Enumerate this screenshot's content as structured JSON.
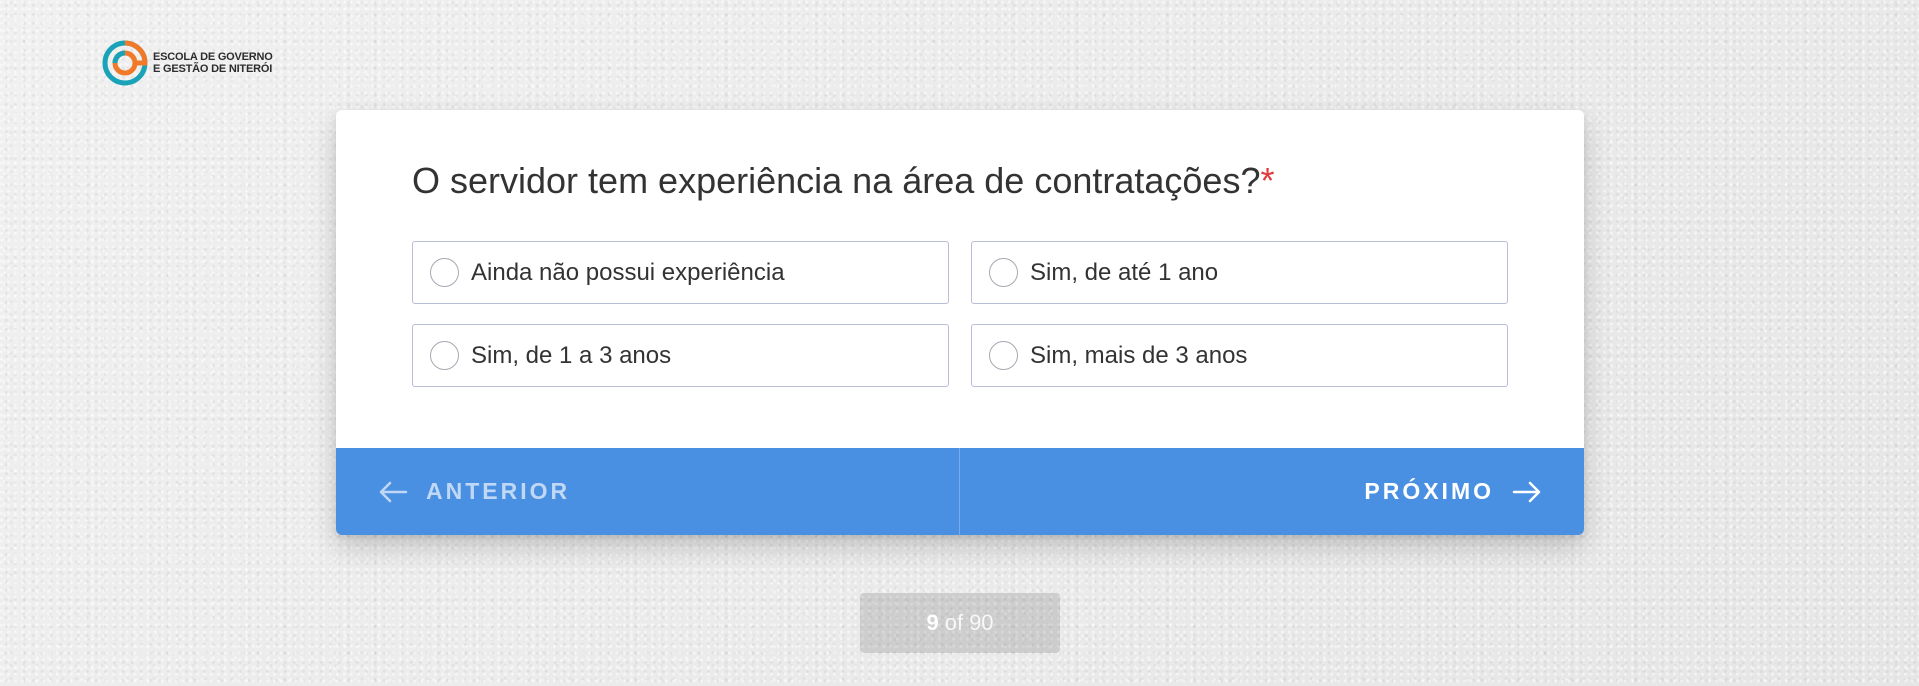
{
  "logo": {
    "line1": "ESCOLA DE GOVERNO",
    "line2": "E GESTÃO DE NITERÓI",
    "icon": "egg-logo-icon"
  },
  "question": {
    "text": "O servidor tem experiência na área de contratações?",
    "required_mark": "*"
  },
  "options": [
    {
      "label": "Ainda não possui experiência",
      "selected": false
    },
    {
      "label": "Sim, de até 1 ano",
      "selected": false
    },
    {
      "label": "Sim, de 1 a 3 anos",
      "selected": false
    },
    {
      "label": "Sim, mais de 3 anos",
      "selected": false
    }
  ],
  "nav": {
    "prev_label": "ANTERIOR",
    "next_label": "PRÓXIMO",
    "prev_icon": "arrow-left-icon",
    "next_icon": "arrow-right-icon"
  },
  "progress": {
    "current": "9",
    "separator": "of",
    "total": "90"
  },
  "colors": {
    "accent": "#4a90e2",
    "required": "#e03a3a",
    "logo_teal": "#1aa3b8",
    "logo_orange": "#f07a2a"
  }
}
